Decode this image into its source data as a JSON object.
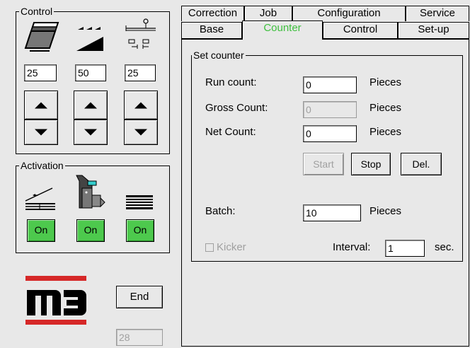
{
  "control": {
    "title": "Control",
    "values": [
      "25",
      "50",
      "25"
    ],
    "icons": [
      "sheet-stack-icon",
      "speed-ramp-icon",
      "stop-position-icon"
    ]
  },
  "activation": {
    "title": "Activation",
    "icons": [
      "feeder-table-icon",
      "printer-unit-icon",
      "output-stack-icon"
    ],
    "buttons": [
      "On",
      "On",
      "On"
    ],
    "button_color": "#4dc94d"
  },
  "logo": {
    "text": "m3",
    "bar_color": "#d62828"
  },
  "end_label": "End",
  "status_value": "28",
  "tabs": {
    "row1": [
      "Correction",
      "Job",
      "Configuration",
      "Service"
    ],
    "row2": [
      "Base",
      "Counter",
      "Control",
      "Set-up"
    ],
    "active": "Counter",
    "active_color": "#3fbf3f"
  },
  "set_counter": {
    "title": "Set counter",
    "run_label": "Run count:",
    "run_value": "0",
    "gross_label": "Gross Count:",
    "gross_value": "0",
    "net_label": "Net Count:",
    "net_value": "0",
    "unit": "Pieces",
    "start_label": "Start",
    "stop_label": "Stop",
    "del_label": "Del.",
    "batch_label": "Batch:",
    "batch_value": "10",
    "kicker_label": "Kicker",
    "interval_label": "Interval:",
    "interval_value": "1",
    "interval_unit": "sec."
  }
}
